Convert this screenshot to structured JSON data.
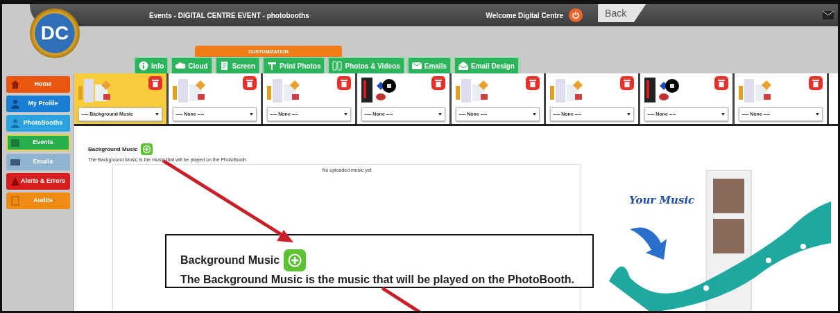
{
  "header": {
    "title": "Events - DIGITAL CENTRE EVENT - photobooths",
    "welcome": "Welcome Digital Centre",
    "back": "Back"
  },
  "logo": {
    "text": "DC"
  },
  "customization_label": "CUSTOMIZATION",
  "tabs": [
    {
      "label": "Info"
    },
    {
      "label": "Cloud"
    },
    {
      "label": "Screen"
    },
    {
      "label": "Print Photos"
    },
    {
      "label": "Photos & Videos"
    },
    {
      "label": "Emails"
    },
    {
      "label": "Email Design"
    }
  ],
  "sidebar": {
    "items": [
      {
        "label": "Home",
        "color": "#e8560f",
        "selected": false
      },
      {
        "label": "My Profile",
        "color": "#1a7fd4",
        "selected": false
      },
      {
        "label": "PhotoBooths",
        "color": "#2aa3e0",
        "selected": false
      },
      {
        "label": "Events",
        "color": "#27ae4f",
        "selected": true
      },
      {
        "label": "Emails",
        "color": "#8fb4cf",
        "selected": false
      },
      {
        "label": "Alerts & Errors",
        "color": "#d81e1e",
        "selected": false
      },
      {
        "label": "Audits",
        "color": "#ef8a12",
        "selected": false
      }
    ]
  },
  "slots": [
    {
      "kind": "props",
      "selected": true,
      "value": "---- Background Music"
    },
    {
      "kind": "props",
      "selected": false,
      "value": "---- None ----"
    },
    {
      "kind": "props",
      "selected": false,
      "value": "---- None ----"
    },
    {
      "kind": "booth",
      "selected": false,
      "value": "---- None ----"
    },
    {
      "kind": "props",
      "selected": false,
      "value": "---- None ----"
    },
    {
      "kind": "props",
      "selected": false,
      "value": "---- None ----"
    },
    {
      "kind": "booth",
      "selected": false,
      "value": "---- None ----"
    },
    {
      "kind": "props",
      "selected": false,
      "value": "---- None ----"
    }
  ],
  "section": {
    "title": "Background Music",
    "description": "The Background Music is the music that will be played on the PhotoBooth.",
    "empty_message": "No uploaded music yet"
  },
  "promo": {
    "caption": "Your Music"
  },
  "callout": {
    "title": "Background Music",
    "description": "The Background Music is the music that will be played on the PhotoBooth."
  }
}
